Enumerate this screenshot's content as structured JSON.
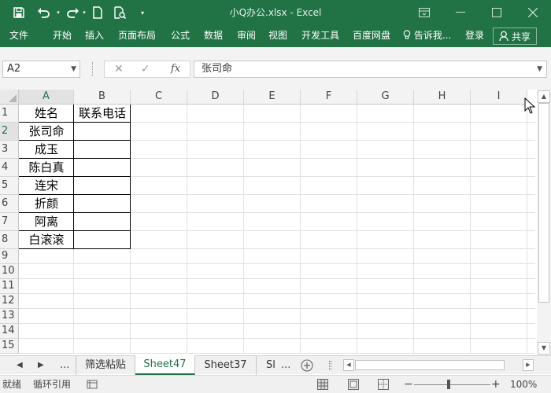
{
  "window": {
    "title": "小Q办公.xlsx - Excel",
    "accent_color": "#217346"
  },
  "quick_access": {
    "icons": [
      "save-icon",
      "undo-icon",
      "redo-icon",
      "new-file-icon",
      "print-preview-icon",
      "customize-icon"
    ]
  },
  "ribbon": {
    "tabs": [
      "文件",
      "开始",
      "插入",
      "页面布局",
      "公式",
      "数据",
      "审阅",
      "视图",
      "开发工具",
      "百度网盘"
    ],
    "tell_me": "告诉我...",
    "login": "登录",
    "share": "共享"
  },
  "formula_bar": {
    "name_box": "A2",
    "fx_label": "fx",
    "formula_value": "张司命"
  },
  "sheet": {
    "columns": [
      "A",
      "B",
      "C",
      "D",
      "E",
      "F",
      "G",
      "H",
      "I"
    ],
    "rows": [
      "1",
      "2",
      "3",
      "4",
      "5",
      "6",
      "7",
      "8",
      "9",
      "10",
      "11",
      "12",
      "13",
      "14",
      "15"
    ],
    "selected_cell": "A2",
    "header": [
      "姓名",
      "联系电话"
    ],
    "names": [
      "张司命",
      "成玉",
      "陈白真",
      "连宋",
      "折颜",
      "阿离",
      "白滚滚"
    ]
  },
  "sheet_tabs": {
    "ellipsis": "...",
    "tabs": [
      "筛选粘贴",
      "Sheet47",
      "Sheet37",
      "Sl"
    ],
    "active": "Sheet47"
  },
  "status_bar": {
    "ready": "就绪",
    "circular": "循环引用",
    "zoom": "100%"
  }
}
